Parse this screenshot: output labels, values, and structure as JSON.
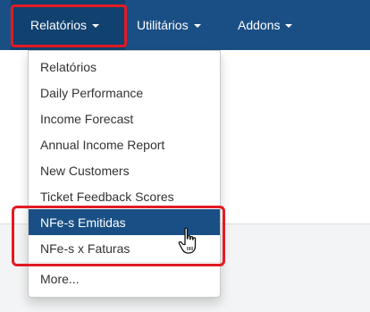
{
  "nav": {
    "menus": [
      {
        "label": "Relatórios"
      },
      {
        "label": "Utilitários"
      },
      {
        "label": "Addons"
      }
    ]
  },
  "dropdown": {
    "items": [
      {
        "label": "Relatórios"
      },
      {
        "label": "Daily Performance"
      },
      {
        "label": "Income Forecast"
      },
      {
        "label": "Annual Income Report"
      },
      {
        "label": "New Customers"
      },
      {
        "label": "Ticket Feedback Scores"
      },
      {
        "label": "NFe-s Emitidas",
        "active": true
      },
      {
        "label": "NFe-s x Faturas"
      },
      {
        "label": "More..."
      }
    ]
  },
  "icons": {
    "caret": "caret-down-icon",
    "cursor": "hand-pointer-icon"
  },
  "colors": {
    "navbar": "#1a4f85",
    "active_menu": "#11416f",
    "highlight": "#e31b23",
    "active_item": "#1a4f85"
  }
}
